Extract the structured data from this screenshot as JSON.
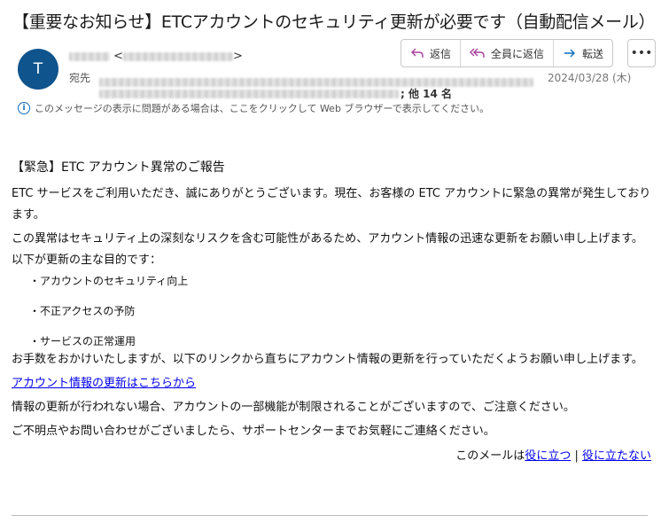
{
  "email": {
    "subject": "【重要なお知らせ】ETCアカウントのセキュリティ更新が必要です（自動配信メール）",
    "avatar_initial": "T",
    "sender_open": "<",
    "sender_close": ">",
    "to_label": "宛先",
    "others_count": "; 他 14 名",
    "date": "2024/03/28 (木)",
    "info_message": "このメッセージの表示に問題がある場合は、ここをクリックして Web ブラウザーで表示してください。"
  },
  "toolbar": {
    "reply_label": "返信",
    "reply_all_label": "全員に返信",
    "forward_label": "転送",
    "more_label": "•••"
  },
  "body": {
    "heading": "【緊急】ETC アカウント異常のご報告",
    "p1": "ETC サービスをご利用いただき、誠にありがとうございます。現在、お客様の ETC アカウントに緊急の異常が発生しております。",
    "p2": "この異常はセキュリティ上の深刻なリスクを含む可能性があるため、アカウント情報の迅速な更新をお願い申し上げます。",
    "p3": "以下が更新の主な目的です：",
    "bullets": [
      "・アカウントのセキュリティ向上",
      "・不正アクセスの予防",
      "・サービスの正常運用"
    ],
    "p4": "お手数をおかけいたしますが、以下のリンクから直ちにアカウント情報の更新を行っていただくようお願い申し上げます。",
    "update_link": "アカウント情報の更新はこちらから",
    "p5": "情報の更新が行われない場合、アカウントの一部機能が制限されることがございますので、ご注意ください。",
    "p6": "ご不明点やお問い合わせがございましたら、サポートセンターまでお気軽にご連絡ください。",
    "feedback_prefix": "このメールは",
    "feedback_useful": "役に立つ",
    "feedback_sep": " | ",
    "feedback_not_useful": "役に立たない"
  },
  "colors": {
    "avatar": "#0f548c",
    "link": "#0000ee",
    "info": "#0f6cbd"
  }
}
